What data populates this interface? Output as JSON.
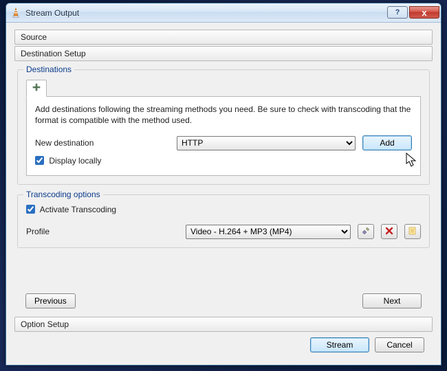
{
  "window": {
    "title": "Stream Output",
    "help_glyph": "?",
    "close_glyph": "x"
  },
  "sections": {
    "source": "Source",
    "destination_setup": "Destination Setup",
    "option_setup": "Option Setup"
  },
  "destinations": {
    "group_title": "Destinations",
    "tab_add_icon": "+",
    "hint": "Add destinations following the streaming methods you need. Be sure to check with transcoding that the format is compatible with the method used.",
    "new_destination_label": "New destination",
    "combo_selected": "HTTP",
    "add_button": "Add",
    "display_locally_label": "Display locally",
    "display_locally_checked": true
  },
  "transcoding": {
    "group_title": "Transcoding options",
    "activate_label": "Activate Transcoding",
    "activate_checked": true,
    "profile_label": "Profile",
    "profile_selected": "Video - H.264 + MP3 (MP4)",
    "tools_icon": "wrench-screwdriver",
    "delete_icon": "delete",
    "new_icon": "new-profile"
  },
  "nav": {
    "previous": "Previous",
    "next": "Next"
  },
  "footer": {
    "stream": "Stream",
    "cancel": "Cancel"
  }
}
